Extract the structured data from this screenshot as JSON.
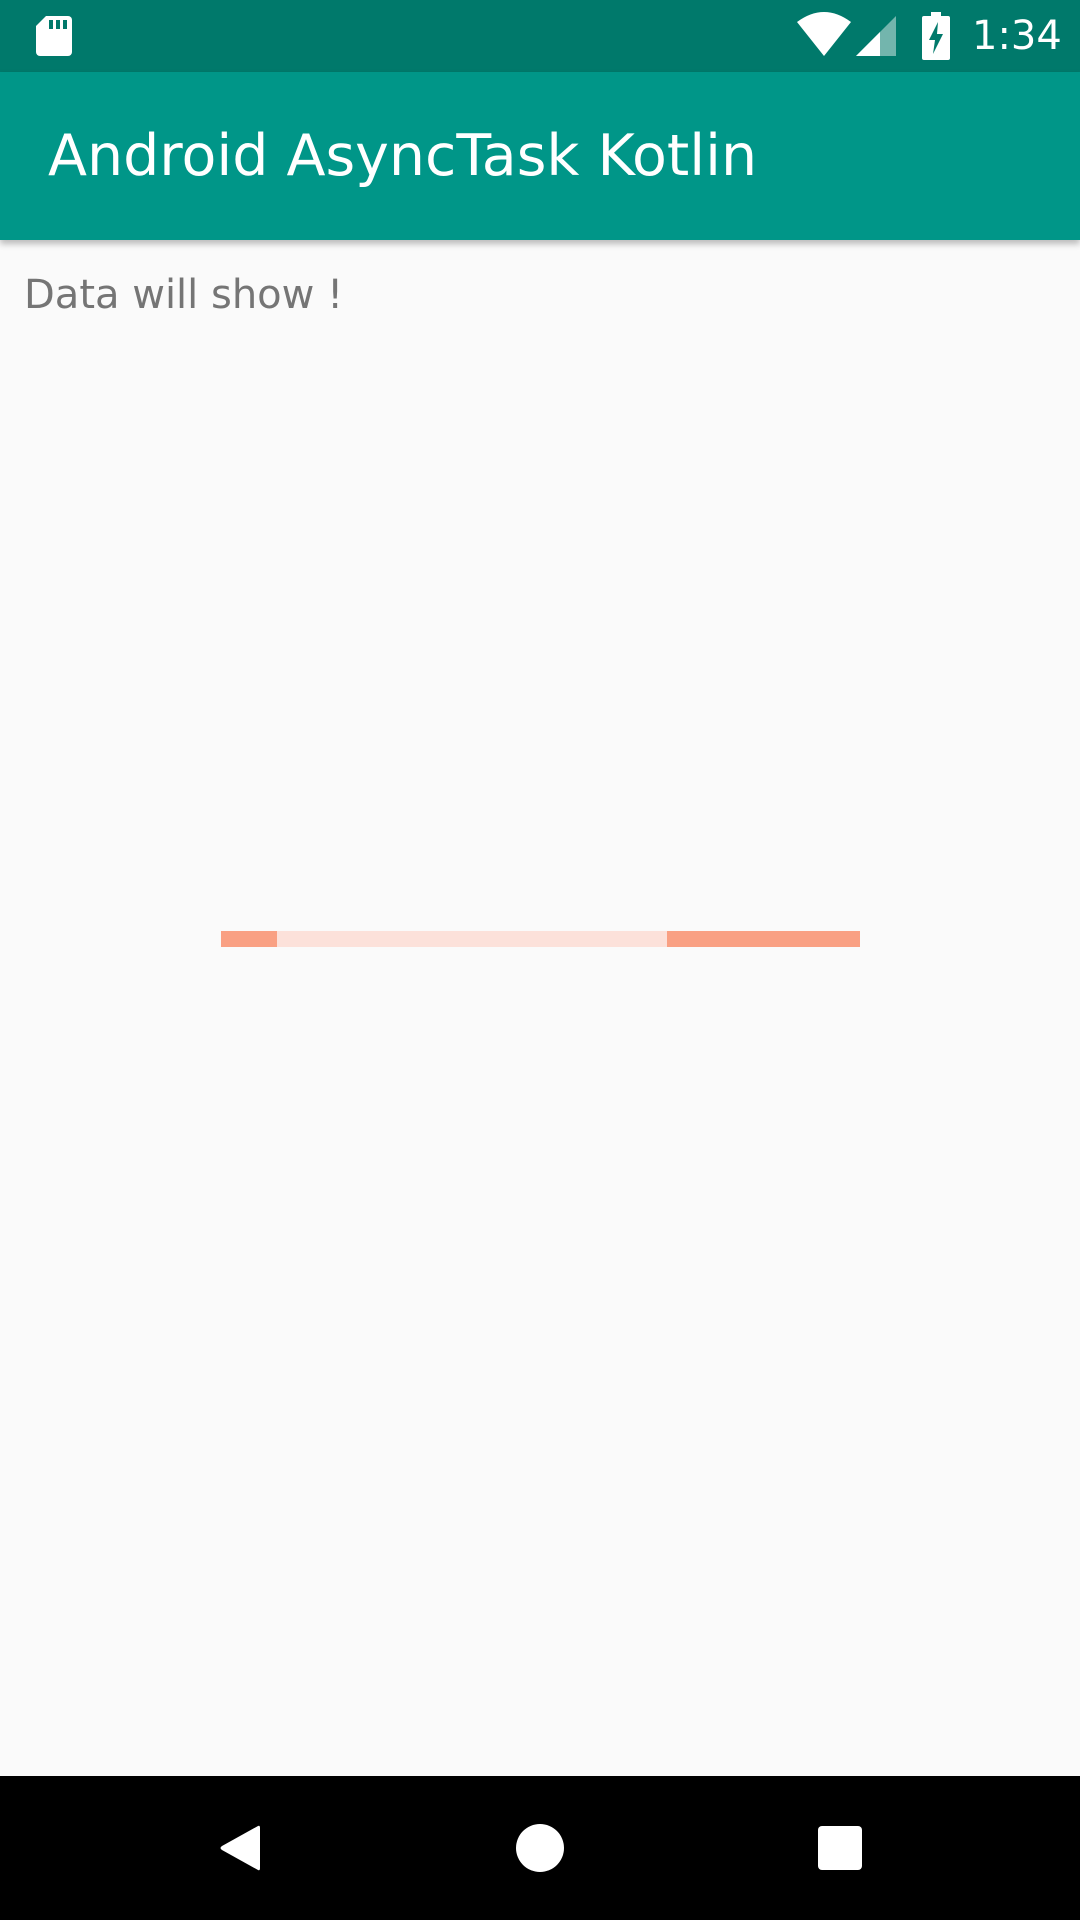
{
  "status_bar": {
    "time": "1:34",
    "icons": [
      "sd-card-icon",
      "wifi-icon",
      "cell-signal-icon",
      "battery-charging-icon"
    ]
  },
  "app_bar": {
    "title": "Android AsyncTask Kotlin"
  },
  "main": {
    "data_text": "Data will show !",
    "progress": {
      "type": "indeterminate-linear",
      "color": "#f9a083",
      "track_color": "#fce1da"
    }
  },
  "navigation_bar": {
    "buttons": [
      "back-icon",
      "home-icon",
      "recents-icon"
    ]
  },
  "colors": {
    "status_bar": "#00796b",
    "app_bar": "#009688",
    "background": "#fafafa",
    "text_secondary": "#757575"
  }
}
